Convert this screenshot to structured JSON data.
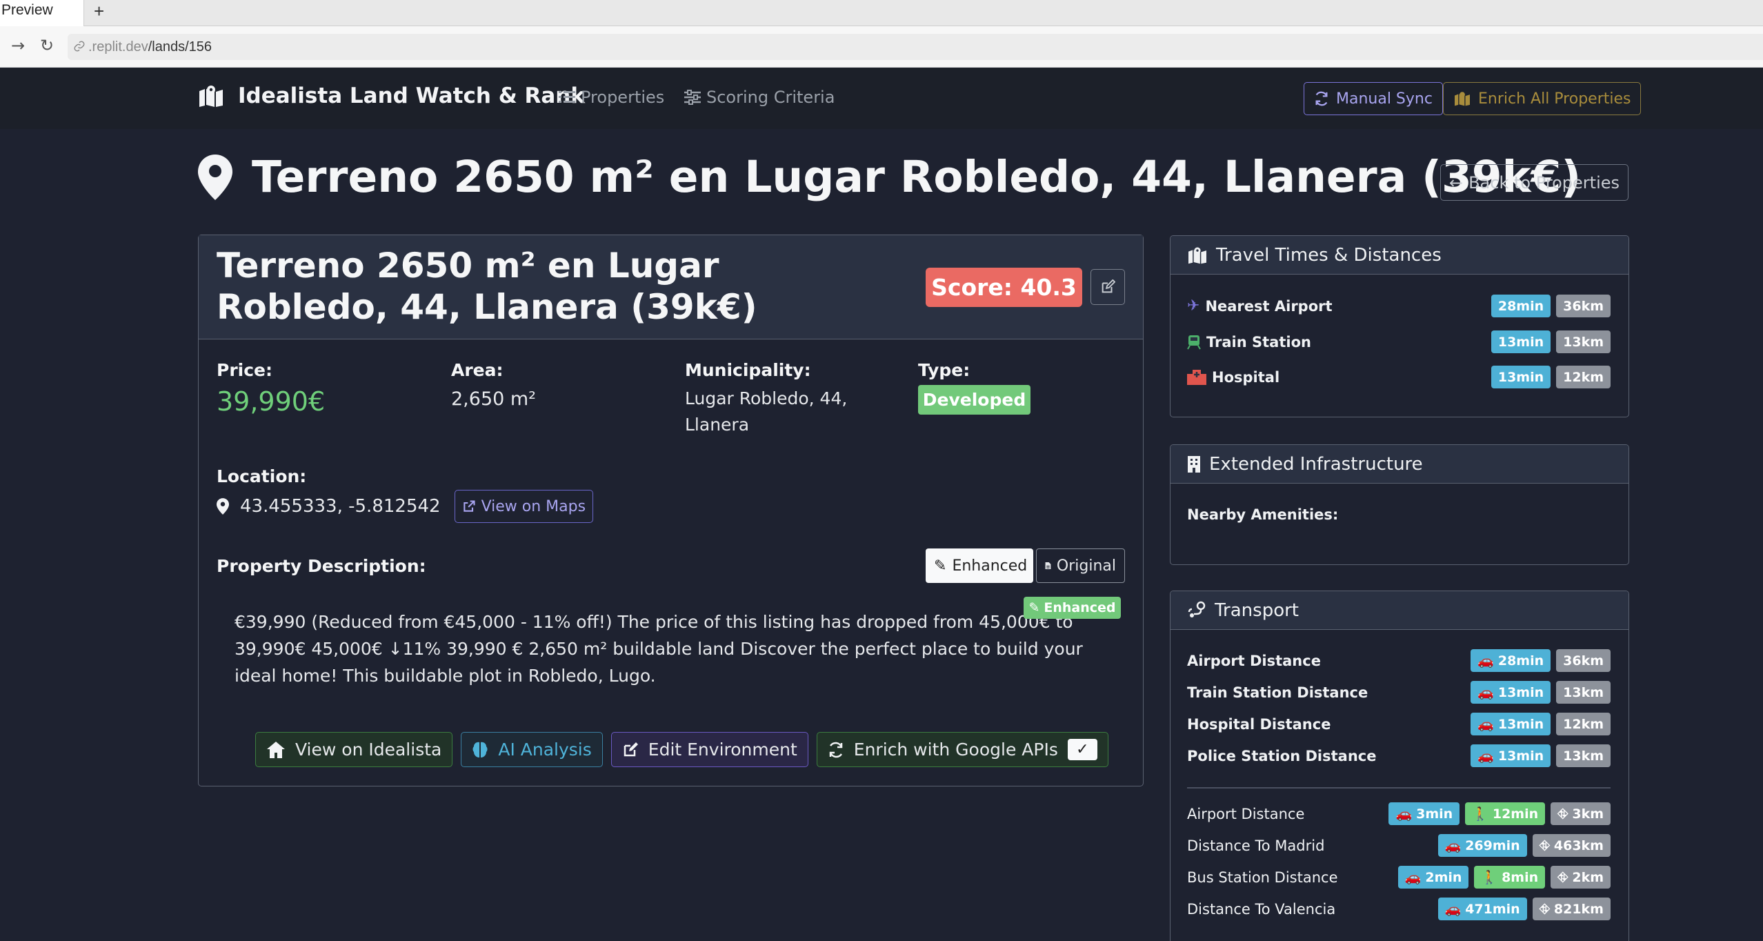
{
  "browser": {
    "tab_title": "Preview",
    "new_tab": "+",
    "url_host": ".replit.dev",
    "url_path": "/lands/156"
  },
  "nav": {
    "brand": "Idealista Land Watch & Rank",
    "properties": "Properties",
    "scoring": "Scoring Criteria",
    "manual_sync": "Manual Sync",
    "enrich_all": "Enrich All Properties"
  },
  "page": {
    "title": "Terreno 2650 m² en Lugar Robledo, 44, Llanera (39k€)",
    "back": "Back to Properties"
  },
  "property": {
    "title": "Terreno 2650 m² en Lugar Robledo, 44, Llanera (39k€)",
    "score": "Score: 40.3",
    "price_label": "Price:",
    "price": "39,990€",
    "area_label": "Area:",
    "area": "2,650 m²",
    "municipality_label": "Municipality:",
    "municipality": "Lugar Robledo, 44, Llanera",
    "type_label": "Type:",
    "type": "Developed",
    "location_label": "Location:",
    "coords": "43.455333, -5.812542",
    "view_maps": "View on Maps",
    "desc_label": "Property Description:",
    "toggle_enhanced": "Enhanced",
    "toggle_original": "Original",
    "enhanced_tag": "Enhanced",
    "description": "€39,990 (Reduced from €45,000 - 11% off!) The price of this listing has dropped from 45,000€ to 39,990€ 45,000€ ↓11% 39,990 € 2,650 m² buildable land Discover the perfect place to build your ideal home! This buildable plot in Robledo, Lugo.",
    "actions": {
      "idealista": "View on Idealista",
      "ai": "AI Analysis",
      "env": "Edit Environment",
      "google": "Enrich with Google APIs",
      "check": "✓"
    }
  },
  "travel": {
    "header": "Travel Times & Distances",
    "rows": [
      {
        "label": "Nearest Airport",
        "time": "28min",
        "dist": "36km"
      },
      {
        "label": "Train Station",
        "time": "13min",
        "dist": "13km"
      },
      {
        "label": "Hospital",
        "time": "13min",
        "dist": "12km"
      }
    ]
  },
  "infra": {
    "header": "Extended Infrastructure",
    "amenities_label": "Nearby Amenities:"
  },
  "transport": {
    "header": "Transport",
    "bold_rows": [
      {
        "label": "Airport Distance",
        "time": "28min",
        "dist": "36km"
      },
      {
        "label": "Train Station Distance",
        "time": "13min",
        "dist": "13km"
      },
      {
        "label": "Hospital Distance",
        "time": "13min",
        "dist": "12km"
      },
      {
        "label": "Police Station Distance",
        "time": "13min",
        "dist": "13km"
      }
    ],
    "rows": [
      {
        "label": "Airport Distance",
        "drive": "3min",
        "walk": "12min",
        "dist": "3km"
      },
      {
        "label": "Distance To Madrid",
        "drive": "269min",
        "dist": "463km"
      },
      {
        "label": "Bus Station Distance",
        "drive": "2min",
        "walk": "8min",
        "dist": "2km"
      },
      {
        "label": "Distance To Valencia",
        "drive": "471min",
        "dist": "821km"
      }
    ]
  },
  "colors": {
    "background": "#1e2230",
    "score": "#ea6a63",
    "price": "#6fcf7a",
    "badge_blue": "#4eb1d6",
    "badge_grey": "#8d929b",
    "accent_purple": "#7b74d9"
  }
}
